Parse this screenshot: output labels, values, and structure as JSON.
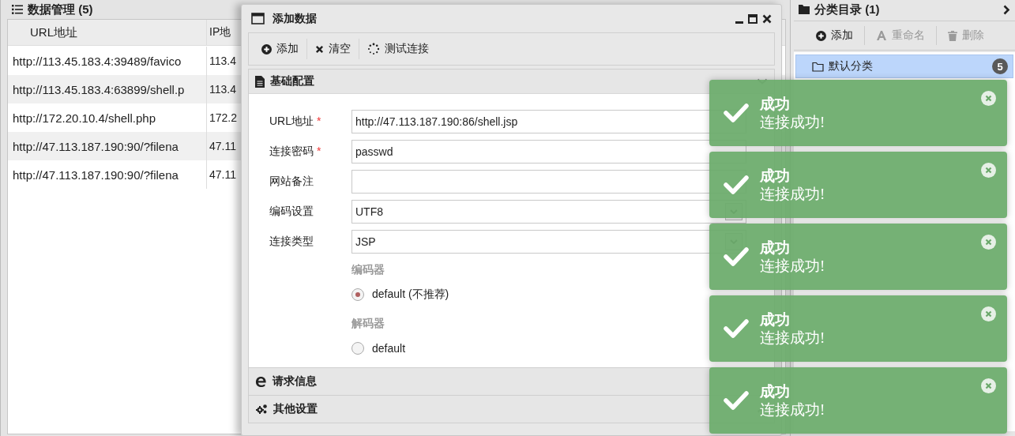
{
  "data_panel": {
    "title": "数据管理 (5)",
    "columns": [
      "URL地址",
      "IP地"
    ],
    "rows": [
      {
        "url": "http://113.45.183.4:39489/favico",
        "ip": "113.4"
      },
      {
        "url": "http://113.45.183.4:63899/shell.p",
        "ip": "113.4"
      },
      {
        "url": "http://172.20.10.4/shell.php",
        "ip": "172.2"
      },
      {
        "url": "http://47.113.187.190:90/?filena",
        "ip": "47.11"
      },
      {
        "url": "http://47.113.187.190:90/?filena",
        "ip": "47.11"
      }
    ]
  },
  "category_panel": {
    "title": "分类目录 (1)",
    "toolbar": [
      {
        "label": "添加",
        "kind": "add",
        "disabled": false
      },
      {
        "label": "重命名",
        "kind": "rename",
        "disabled": true
      },
      {
        "label": "删除",
        "kind": "delete",
        "disabled": true
      }
    ],
    "items": [
      {
        "label": "默认分类",
        "count": "5",
        "selected": true
      }
    ]
  },
  "dialog": {
    "title": "添加数据",
    "toolbar": [
      {
        "label": "添加",
        "kind": "add"
      },
      {
        "label": "清空",
        "kind": "clear"
      },
      {
        "label": "测试连接",
        "kind": "test"
      }
    ],
    "sections": [
      {
        "title": "基础配置",
        "kind": "file",
        "expanded": true
      },
      {
        "title": "请求信息",
        "kind": "e",
        "expanded": false
      },
      {
        "title": "其他设置",
        "kind": "gears",
        "expanded": false
      }
    ],
    "fields": [
      {
        "label": "URL地址",
        "kind": "text",
        "required_mark": "*",
        "value": "http://47.113.187.190:86/shell.jsp"
      },
      {
        "label": "连接密码",
        "kind": "text",
        "required_mark": "*",
        "value": "passwd"
      },
      {
        "label": "网站备注",
        "kind": "text"
      },
      {
        "label": "编码设置",
        "kind": "select",
        "value": "UTF8"
      },
      {
        "label": "连接类型",
        "kind": "select",
        "value": "JSP"
      }
    ],
    "radio_groups": [
      {
        "label": "编码器",
        "options": [
          {
            "label": "default (不推荐)",
            "selected": true
          }
        ]
      },
      {
        "label": "解码器",
        "options": [
          {
            "label": "default",
            "selected": false
          }
        ]
      }
    ]
  },
  "toasts": [
    {
      "title": "成功",
      "message": "连接成功!"
    },
    {
      "title": "成功",
      "message": "连接成功!"
    },
    {
      "title": "成功",
      "message": "连接成功!"
    },
    {
      "title": "成功",
      "message": "连接成功!"
    },
    {
      "title": "成功",
      "message": "连接成功!"
    }
  ]
}
